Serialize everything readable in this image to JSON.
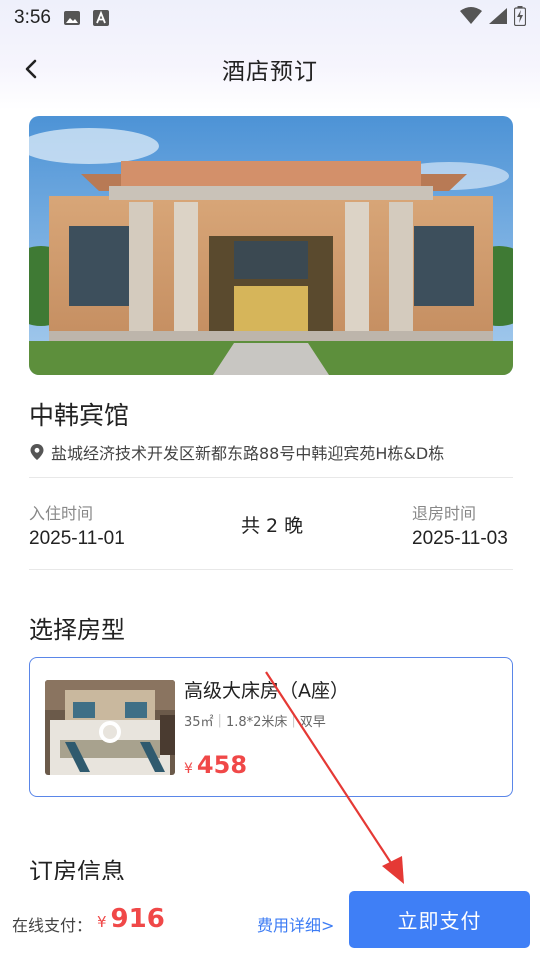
{
  "status_bar": {
    "time": "3:56"
  },
  "nav": {
    "title": "酒店预订"
  },
  "hotel": {
    "name": "中韩宾馆",
    "address": "盐城经济技术开发区新都东路88号中韩迎宾苑H栋&D栋"
  },
  "stay": {
    "checkin_label": "入住时间",
    "checkin_date": "2025-11-01",
    "nights": "共 2 晚",
    "checkout_label": "退房时间",
    "checkout_date": "2025-11-03"
  },
  "room_section": {
    "title": "选择房型"
  },
  "room": {
    "name": "高级大床房（A座）",
    "area": "35㎡",
    "bed": "1.8*2米床",
    "breakfast": "双早",
    "currency": "¥",
    "price": "458"
  },
  "booking_section": {
    "title": "订房信息"
  },
  "bottom": {
    "pay_label": "在线支付：",
    "currency": "¥",
    "amount": "916",
    "fee_link": "费用详细>",
    "pay_button": "立即支付"
  },
  "colors": {
    "accent": "#3f7ff6",
    "price": "#f04848",
    "annotation": "#e53935"
  }
}
